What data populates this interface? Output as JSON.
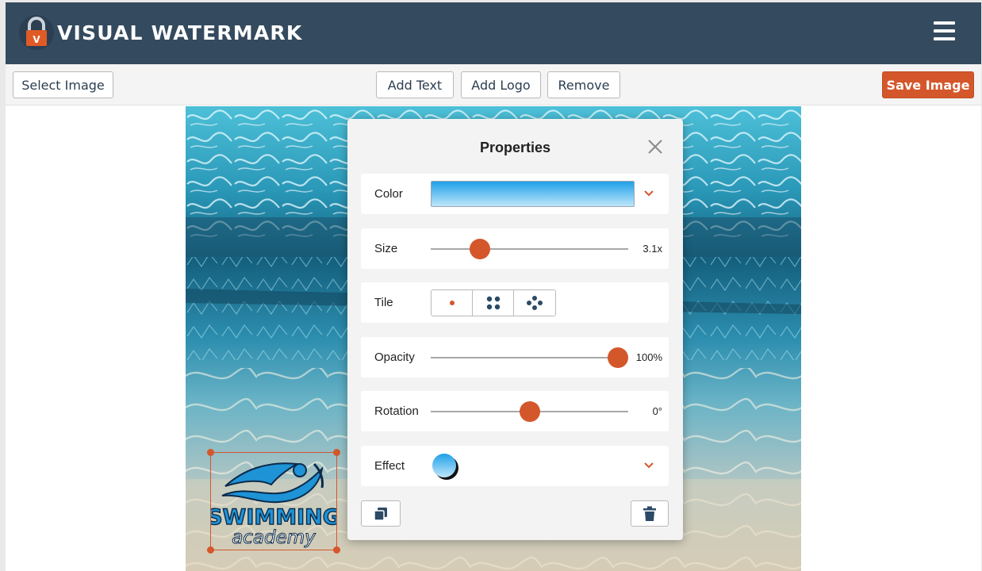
{
  "header": {
    "title": "VISUAL WATERMARK",
    "logo_icon": "padlock-logo-icon",
    "menu_icon": "hamburger-menu-icon"
  },
  "toolbar": {
    "select_image": "Select Image",
    "add_text": "Add Text",
    "add_logo": "Add Logo",
    "remove": "Remove",
    "save_image": "Save Image"
  },
  "watermark": {
    "line1": "SWIMMING",
    "line2": "academy"
  },
  "properties": {
    "title": "Properties",
    "color_label": "Color",
    "size_label": "Size",
    "size_value": "3.1x",
    "size_level": 0.22,
    "tile_label": "Tile",
    "tile_options": [
      "single-dot-icon",
      "four-dots-grid-icon",
      "diamond-dots-icon"
    ],
    "opacity_label": "Opacity",
    "opacity_value": "100%",
    "opacity_level": 1.0,
    "rotation_label": "Rotation",
    "rotation_value": "0°",
    "rotation_level": 0.5,
    "effect_label": "Effect"
  },
  "colors": {
    "header_bg": "#344a5e",
    "accent": "#d4572b",
    "icon_dark": "#2c4a66"
  }
}
